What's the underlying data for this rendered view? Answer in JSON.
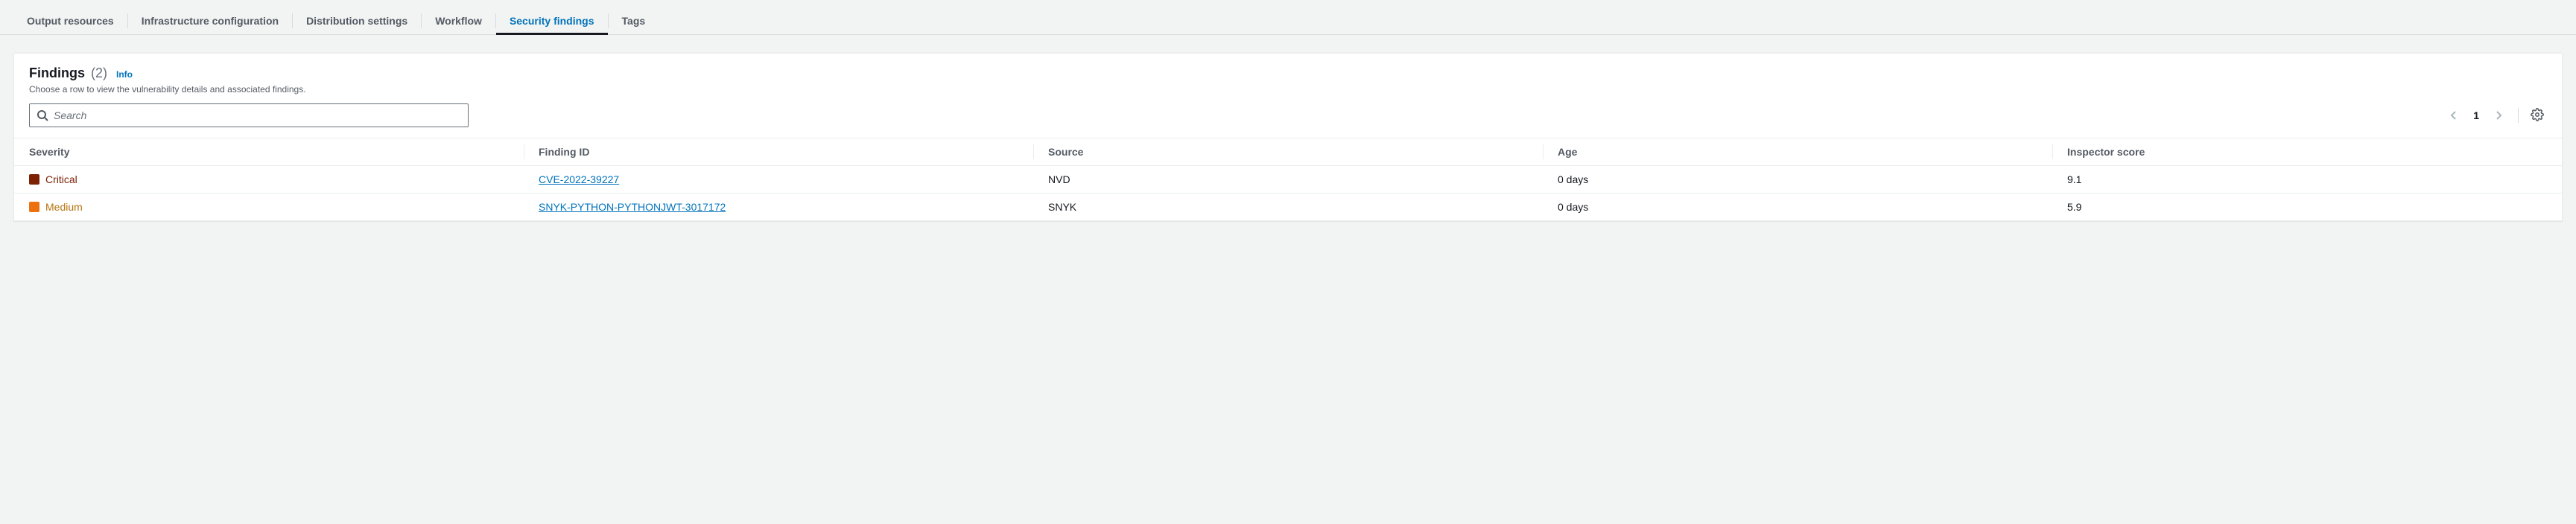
{
  "tabs": [
    {
      "label": "Output resources",
      "active": false
    },
    {
      "label": "Infrastructure configuration",
      "active": false
    },
    {
      "label": "Distribution settings",
      "active": false
    },
    {
      "label": "Workflow",
      "active": false
    },
    {
      "label": "Security findings",
      "active": true
    },
    {
      "label": "Tags",
      "active": false
    }
  ],
  "findings": {
    "title": "Findings",
    "count": "(2)",
    "info_label": "Info",
    "subtitle": "Choose a row to view the vulnerability details and associated findings.",
    "search_placeholder": "Search",
    "page_number": "1",
    "columns": {
      "severity": "Severity",
      "finding_id": "Finding ID",
      "source": "Source",
      "age": "Age",
      "inspector_score": "Inspector score"
    },
    "rows": [
      {
        "severity_level": "Critical",
        "severity_class": "critical",
        "finding_id": "CVE-2022-39227",
        "source": "NVD",
        "age": "0 days",
        "inspector_score": "9.1"
      },
      {
        "severity_level": "Medium",
        "severity_class": "medium",
        "finding_id": "SNYK-PYTHON-PYTHONJWT-3017172",
        "source": "SNYK",
        "age": "0 days",
        "inspector_score": "5.9"
      }
    ]
  }
}
